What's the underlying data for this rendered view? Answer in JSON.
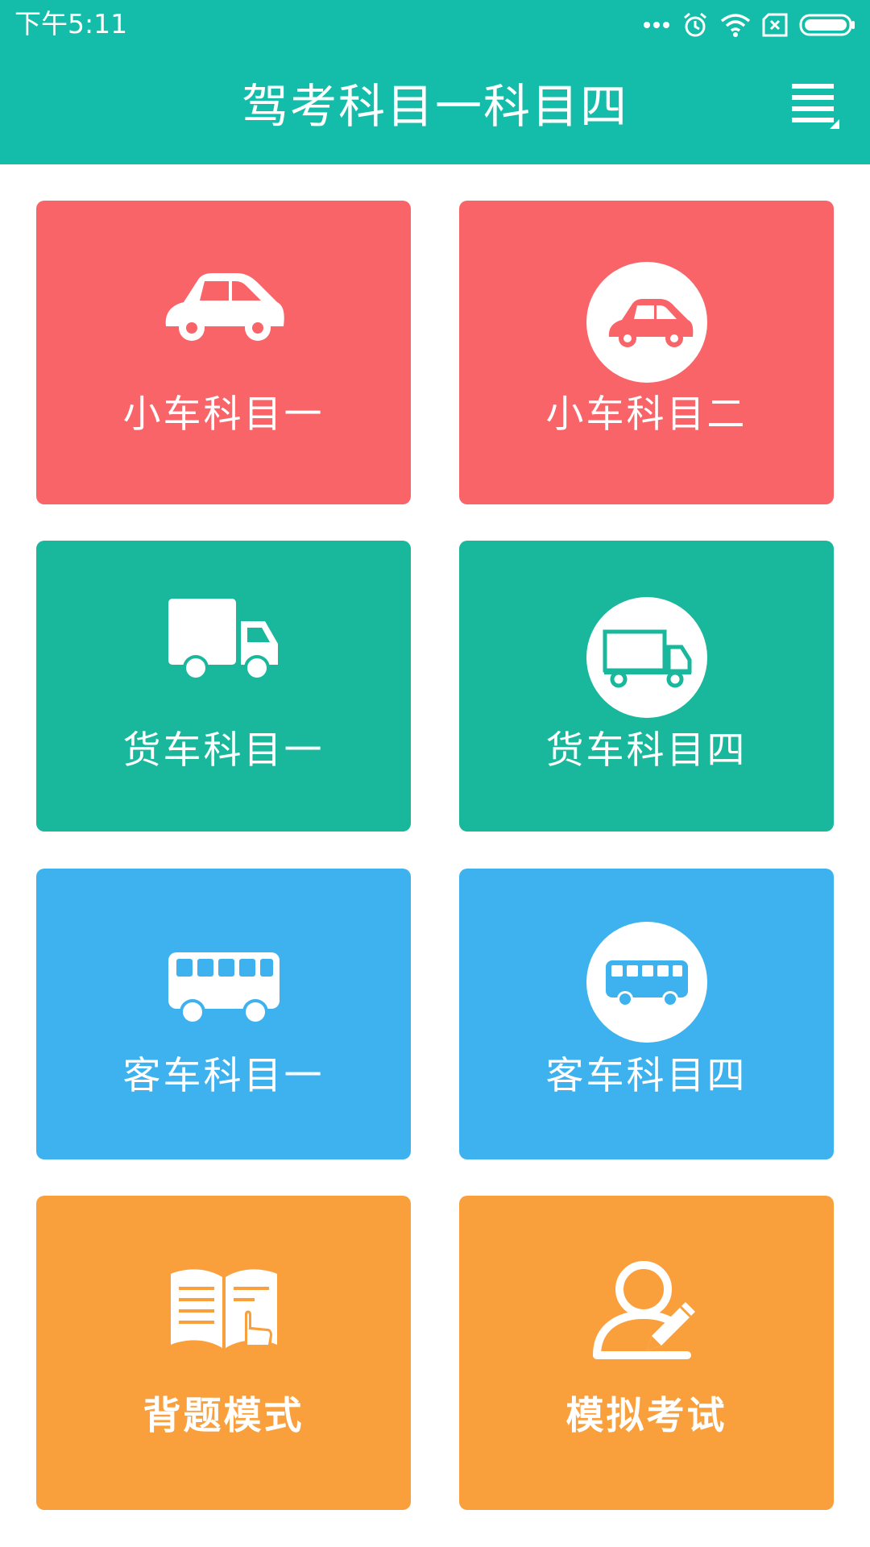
{
  "status_bar": {
    "time": "下午5:11",
    "icons": [
      "more-dots-icon",
      "alarm-icon",
      "wifi-icon",
      "sim-off-icon",
      "battery-icon"
    ]
  },
  "header": {
    "title": "驾考科目一科目四",
    "menu_icon": "menu-icon"
  },
  "tiles": [
    {
      "label": "小车科目一",
      "icon": "car-icon",
      "color": "#f96469"
    },
    {
      "label": "小车科目二",
      "icon": "car-circle-icon",
      "color": "#f96469"
    },
    {
      "label": "货车科目一",
      "icon": "truck-icon",
      "color": "#19b79c"
    },
    {
      "label": "货车科目四",
      "icon": "truck-circle-icon",
      "color": "#19b79c"
    },
    {
      "label": "客车科目一",
      "icon": "bus-icon",
      "color": "#3db2ee"
    },
    {
      "label": "客车科目四",
      "icon": "bus-circle-icon",
      "color": "#3db2ee"
    },
    {
      "label": "背题模式",
      "icon": "book-icon",
      "color": "#f99f3c"
    },
    {
      "label": "模拟考试",
      "icon": "exam-user-icon",
      "color": "#f99f3c"
    }
  ],
  "colors": {
    "brand": "#14bda9",
    "red": "#f96469",
    "green": "#19b79c",
    "blue": "#3db2ee",
    "orange": "#f99f3c"
  }
}
